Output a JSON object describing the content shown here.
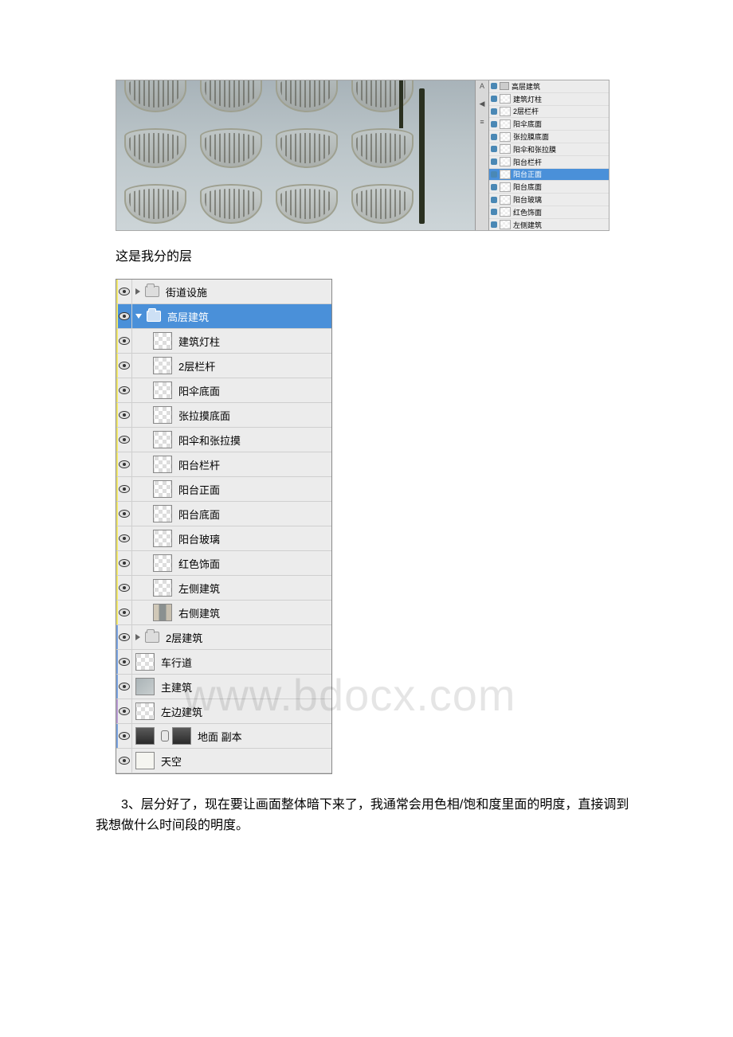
{
  "figure1": {
    "mini_layers": [
      {
        "label": "高层建筑",
        "type": "folder",
        "selected": false
      },
      {
        "label": "建筑灯柱",
        "type": "layer",
        "selected": false
      },
      {
        "label": "2层栏杆",
        "type": "layer",
        "selected": false
      },
      {
        "label": "阳伞底面",
        "type": "layer",
        "selected": false
      },
      {
        "label": "张拉膜底面",
        "type": "layer",
        "selected": false
      },
      {
        "label": "阳伞和张拉膜",
        "type": "layer",
        "selected": false
      },
      {
        "label": "阳台栏杆",
        "type": "layer",
        "selected": false
      },
      {
        "label": "阳台正面",
        "type": "layer",
        "selected": true
      },
      {
        "label": "阳台底面",
        "type": "layer",
        "selected": false
      },
      {
        "label": "阳台玻璃",
        "type": "layer",
        "selected": false
      },
      {
        "label": "红色饰面",
        "type": "layer",
        "selected": false
      },
      {
        "label": "左侧建筑",
        "type": "layer",
        "selected": false
      },
      {
        "label": "右侧建筑",
        "type": "layer",
        "selected": false
      }
    ]
  },
  "caption1": "这是我分的层",
  "layers": [
    {
      "label": "街道设施",
      "type": "group",
      "indent": 0,
      "open": false,
      "color": "yellow",
      "thumb": "folder"
    },
    {
      "label": "高层建筑",
      "type": "group",
      "indent": 0,
      "open": true,
      "selected": true,
      "color": "yellow",
      "thumb": "folder"
    },
    {
      "label": "建筑灯柱",
      "type": "layer",
      "indent": 1,
      "color": "yellow",
      "thumb": "checker"
    },
    {
      "label": "2层栏杆",
      "type": "layer",
      "indent": 1,
      "color": "yellow",
      "thumb": "checker"
    },
    {
      "label": "阳伞底面",
      "type": "layer",
      "indent": 1,
      "color": "yellow",
      "thumb": "checker"
    },
    {
      "label": "张拉摸底面",
      "type": "layer",
      "indent": 1,
      "color": "yellow",
      "thumb": "checker"
    },
    {
      "label": "阳伞和张拉摸",
      "type": "layer",
      "indent": 1,
      "color": "yellow",
      "thumb": "checker"
    },
    {
      "label": "阳台栏杆",
      "type": "layer",
      "indent": 1,
      "color": "yellow",
      "thumb": "checker"
    },
    {
      "label": "阳台正面",
      "type": "layer",
      "indent": 1,
      "color": "yellow",
      "thumb": "checker"
    },
    {
      "label": "阳台底面",
      "type": "layer",
      "indent": 1,
      "color": "yellow",
      "thumb": "checker"
    },
    {
      "label": "阳台玻璃",
      "type": "layer",
      "indent": 1,
      "color": "yellow",
      "thumb": "checker"
    },
    {
      "label": "红色饰面",
      "type": "layer",
      "indent": 1,
      "color": "yellow",
      "thumb": "checker"
    },
    {
      "label": "左侧建筑",
      "type": "layer",
      "indent": 1,
      "color": "yellow",
      "thumb": "checker"
    },
    {
      "label": "右侧建筑",
      "type": "layer",
      "indent": 1,
      "color": "yellow",
      "thumb": "mix"
    },
    {
      "label": "2层建筑",
      "type": "group",
      "indent": 0,
      "open": false,
      "color": "blue",
      "thumb": "folder"
    },
    {
      "label": "车行道",
      "type": "layer",
      "indent": 0,
      "color": "blue",
      "thumb": "checker"
    },
    {
      "label": "主建筑",
      "type": "layer",
      "indent": 0,
      "color": "blue",
      "thumb": "solid"
    },
    {
      "label": "左边建筑",
      "type": "layer",
      "indent": 0,
      "color": "purple",
      "thumb": "checker"
    },
    {
      "label": "地面 副本",
      "type": "layer",
      "indent": 0,
      "color": "blue",
      "thumb": "dark",
      "linked": true,
      "mask": true
    },
    {
      "label": "天空",
      "type": "layer",
      "indent": 0,
      "color": "none",
      "thumb": "light"
    }
  ],
  "body_text": "3、层分好了，现在要让画面整体暗下来了，我通常会用色相/饱和度里面的明度，直接调到我想做什么时间段的明度。",
  "watermark": "www.bdocx.com"
}
